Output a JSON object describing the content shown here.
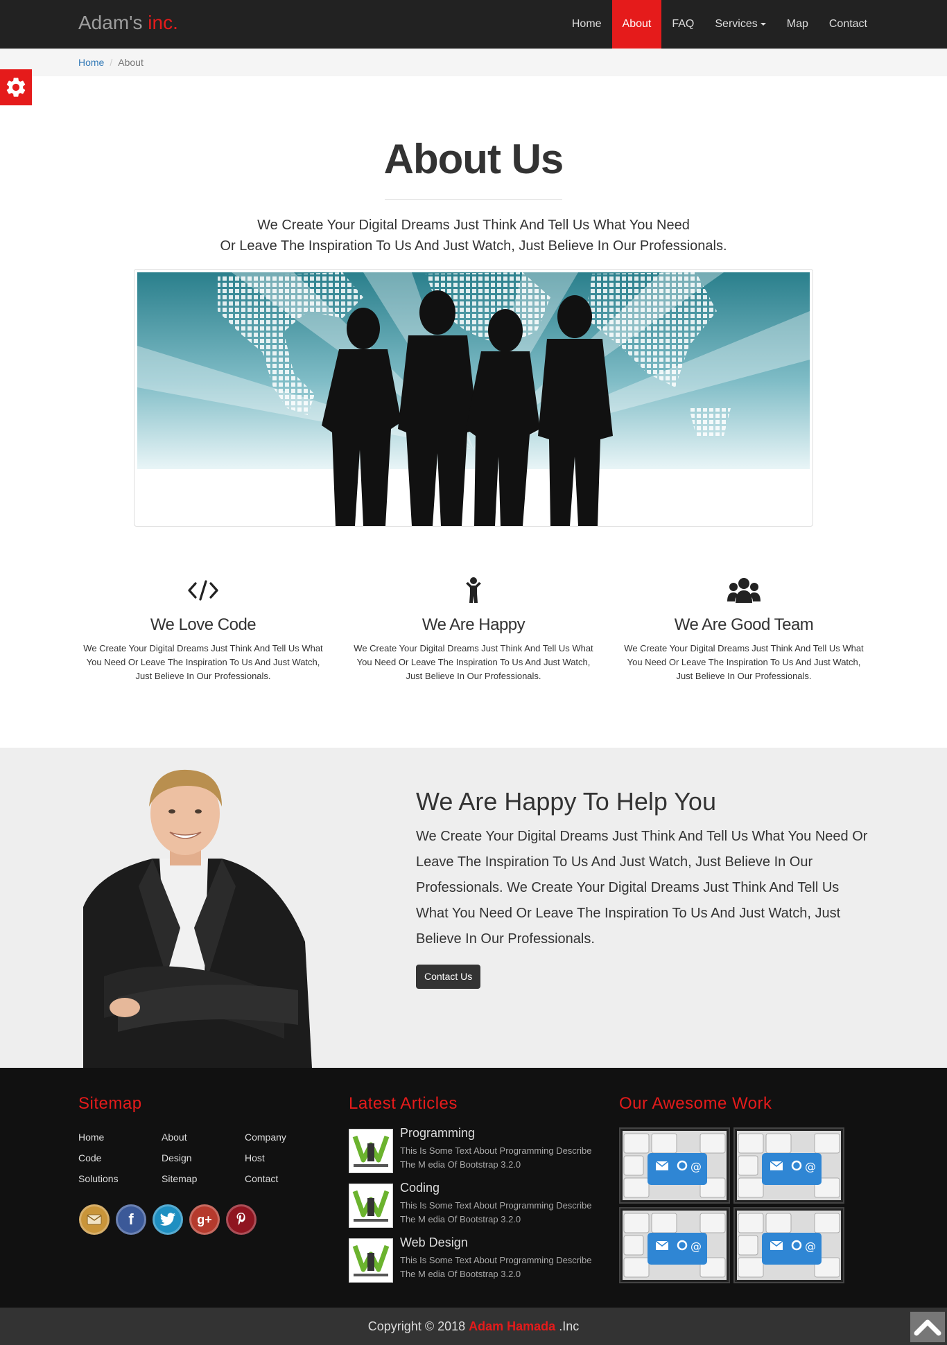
{
  "brand": {
    "name": "Adam's",
    "accent": "inc."
  },
  "nav": {
    "home": "Home",
    "about": "About",
    "faq": "FAQ",
    "services": "Services",
    "map": "Map",
    "contact": "Contact",
    "active": "About"
  },
  "breadcrumb": {
    "home": "Home",
    "separator": "/",
    "current": "About"
  },
  "about": {
    "title": "About Us",
    "subtitle_line1": "We Create Your Digital Dreams Just Think And Tell Us What You Need",
    "subtitle_line2": "Or Leave The Inspiration To Us And Just Watch, Just Believe In Our Professionals."
  },
  "features": [
    {
      "icon": "code-icon",
      "title": "We Love Code",
      "text": "We Create Your Digital Dreams Just Think And Tell Us What You Need Or Leave The Inspiration To Us And Just Watch, Just Believe In Our Professionals."
    },
    {
      "icon": "child-icon",
      "title": "We Are Happy",
      "text": "We Create Your Digital Dreams Just Think And Tell Us What You Need Or Leave The Inspiration To Us And Just Watch, Just Believe In Our Professionals."
    },
    {
      "icon": "users-icon",
      "title": "We Are Good Team",
      "text": "We Create Your Digital Dreams Just Think And Tell Us What You Need Or Leave The Inspiration To Us And Just Watch, Just Believe In Our Professionals."
    }
  ],
  "help": {
    "title": "We Are Happy To Help You",
    "text": "We Create Your Digital Dreams Just Think And Tell Us What You Need Or Leave The Inspiration To Us And Just Watch, Just Believe In Our Professionals. We Create Your Digital Dreams Just Think And Tell Us What You Need Or Leave The Inspiration To Us And Just Watch, Just Believe In Our Professionals.",
    "button": "Contact Us"
  },
  "footer": {
    "sitemap_title": "Sitemap",
    "sitemap_links": [
      "Home",
      "About",
      "Company",
      "Code",
      "Design",
      "Host",
      "Solutions",
      "Sitemap",
      "Contact"
    ],
    "social": [
      "email-icon",
      "facebook-icon",
      "twitter-icon",
      "google-plus-icon",
      "pinterest-icon"
    ],
    "articles_title": "Latest Articles",
    "articles": [
      {
        "title": "Programming",
        "text": "This Is Some Text About Programming Describe The M edia Of Bootstrap 3.2.0"
      },
      {
        "title": "Coding",
        "text": "This Is Some Text About Programming Describe The M edia Of Bootstrap 3.2.0"
      },
      {
        "title": "Web Design",
        "text": "This Is Some Text About Programming Describe The M edia Of Bootstrap 3.2.0"
      }
    ],
    "work_title": "Our Awesome Work"
  },
  "copyright": {
    "prefix": "Copyright © 2018",
    "name": "Adam Hamada",
    "suffix": ".Inc"
  },
  "colors": {
    "accent": "#e51b1b",
    "navbar": "#222222",
    "footer": "#111111",
    "help_bg": "#eeeeee"
  }
}
